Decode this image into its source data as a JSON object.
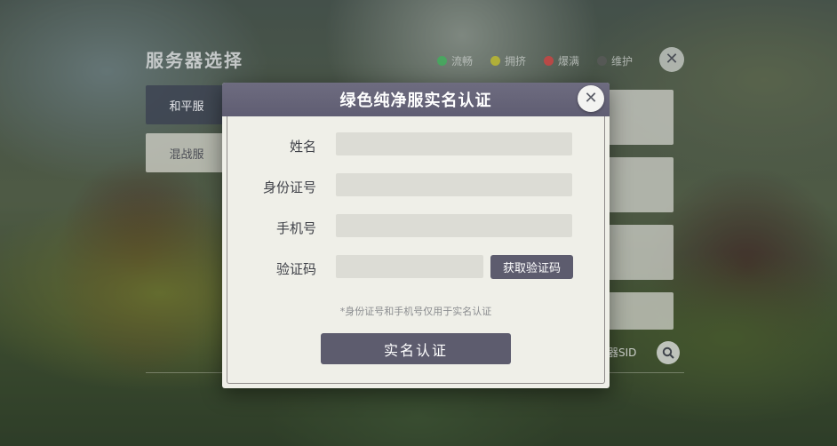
{
  "background": {
    "title": "服务器选择",
    "legend": [
      {
        "label": "流畅",
        "color": "#3db35a"
      },
      {
        "label": "拥挤",
        "color": "#c7c228"
      },
      {
        "label": "爆满",
        "color": "#d84040"
      },
      {
        "label": "维护",
        "color": "#5a5a5a"
      }
    ],
    "close_icon": "close-icon",
    "tabs": [
      {
        "label": "和平服"
      },
      {
        "label": "混战服"
      }
    ],
    "sid_label": "器SID",
    "search_icon": "search-icon"
  },
  "modal": {
    "title": "绿色纯净服实名认证",
    "close_icon": "close-icon",
    "fields": {
      "name_label": "姓名",
      "id_label": "身份证号",
      "phone_label": "手机号",
      "code_label": "验证码"
    },
    "get_code_button": "获取验证码",
    "note": "*身份证号和手机号仅用于实名认证",
    "submit_button": "实名认证"
  }
}
